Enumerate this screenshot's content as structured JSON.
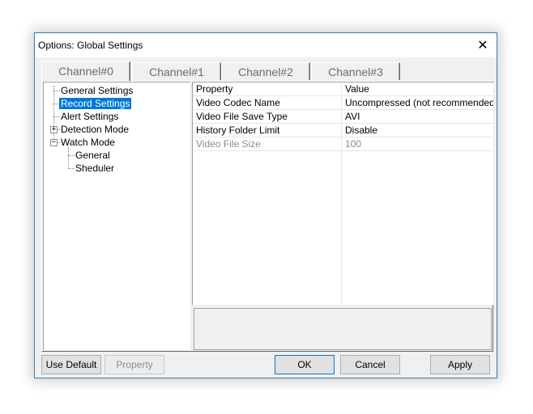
{
  "window": {
    "title": "Options:   Global Settings",
    "close_symbol": "✕"
  },
  "tabs": [
    "Channel#0",
    "Channel#1",
    "Channel#2",
    "Channel#3"
  ],
  "active_tab": 0,
  "tree": {
    "items": [
      {
        "label": "General Settings",
        "selected": false
      },
      {
        "label": "Record Settings",
        "selected": true
      },
      {
        "label": "Alert Settings",
        "selected": false
      },
      {
        "label": "Detection Mode",
        "selected": false,
        "expander": "+"
      },
      {
        "label": "Watch Mode",
        "selected": false,
        "expander": "−"
      },
      {
        "label": "General",
        "selected": false
      },
      {
        "label": "Sheduler",
        "selected": false
      }
    ]
  },
  "grid": {
    "headers": {
      "property": "Property",
      "value": "Value"
    },
    "rows": [
      {
        "property": "Video Codec Name",
        "value": "Uncompressed (not recommended)",
        "disabled": false
      },
      {
        "property": "Video File Save Type",
        "value": "AVI",
        "disabled": false
      },
      {
        "property": "History Folder Limit",
        "value": "Disable",
        "disabled": false
      },
      {
        "property": "Video File Size",
        "value": "100",
        "disabled": true
      }
    ]
  },
  "buttons": {
    "use_default": "Use Default",
    "property": "Property",
    "ok": "OK",
    "cancel": "Cancel",
    "apply": "Apply"
  },
  "colors": {
    "selection": "#0078d7",
    "window_border": "#3c7fb1",
    "face": "#f0f0f0"
  }
}
